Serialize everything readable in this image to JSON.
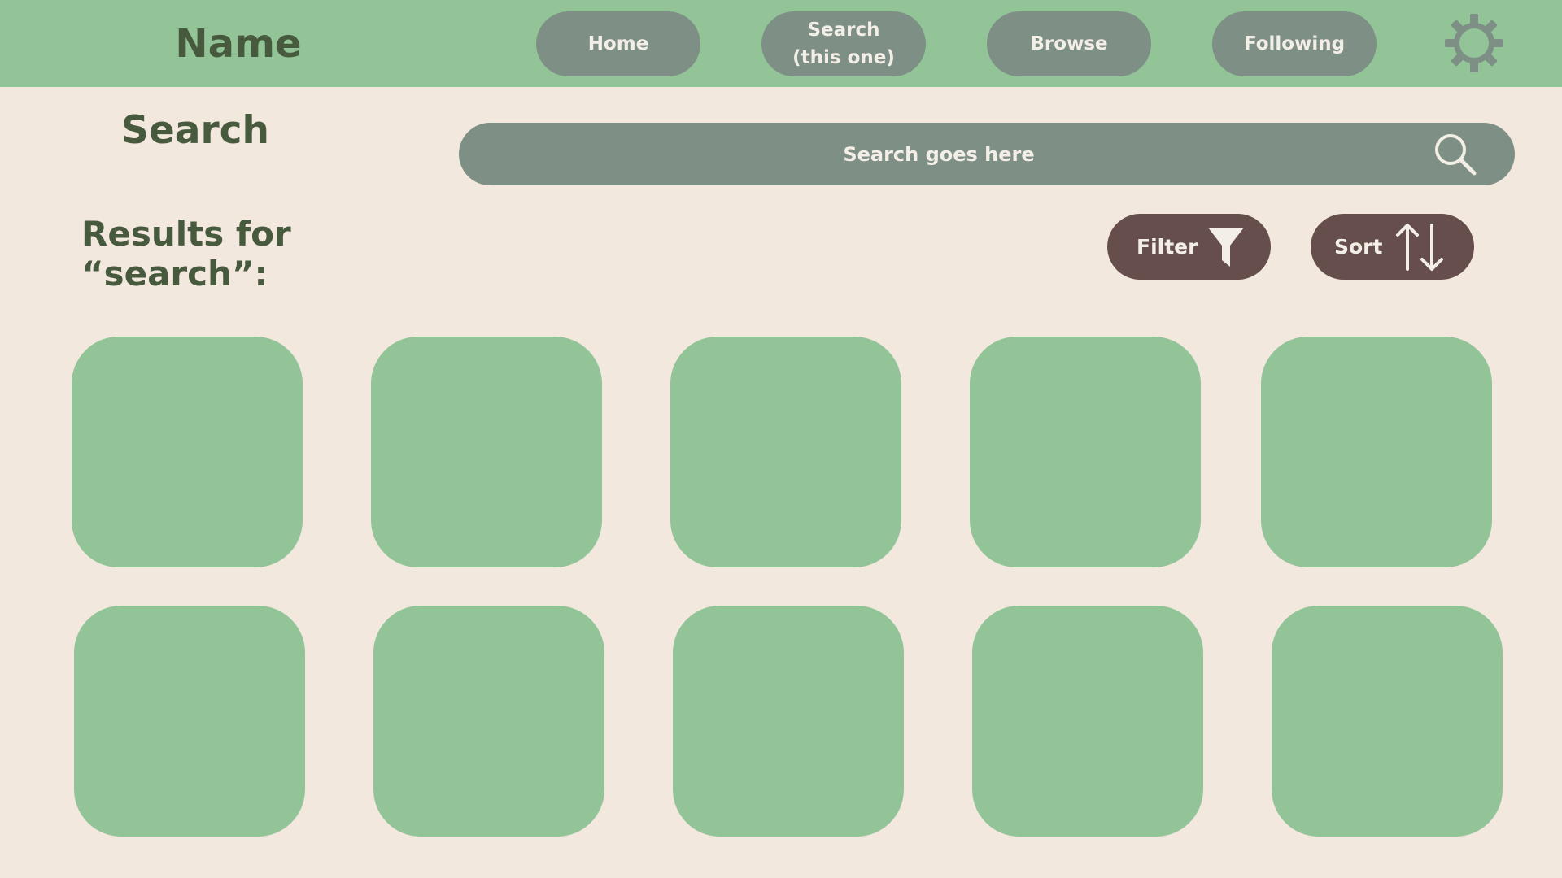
{
  "colors": {
    "background": "#f2e8dd",
    "topbar": "#92c498",
    "nav_button": "#7e8f85",
    "action_button": "#654e4c",
    "heading_text": "#475a3d",
    "tile": "#92c498"
  },
  "header": {
    "app_name": "Name",
    "nav": [
      {
        "label": "Home"
      },
      {
        "label": "Search\n(this one)"
      },
      {
        "label": "Browse"
      },
      {
        "label": "Following"
      }
    ],
    "settings_icon": "gear-icon"
  },
  "search": {
    "title": "Search",
    "placeholder": "Search goes here",
    "icon": "search-icon"
  },
  "results": {
    "title": "Results for “search”:",
    "filter_label": "Filter",
    "filter_icon": "funnel-icon",
    "sort_label": "Sort",
    "sort_icon": "sort-arrows-icon",
    "tile_count": 10
  }
}
